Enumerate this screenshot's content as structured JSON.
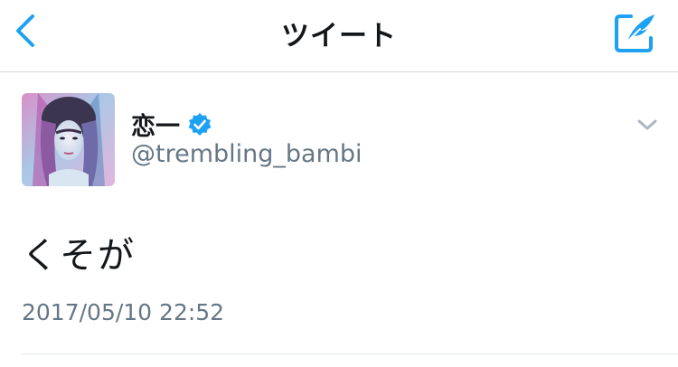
{
  "colors": {
    "accent": "#1da1f2",
    "text_primary": "#14171a",
    "text_secondary": "#657786",
    "divider": "#e1e8ed"
  },
  "navbar": {
    "back_icon": "chevron-left-icon",
    "title": "ツイート",
    "compose_icon": "compose-tweet-icon"
  },
  "tweet": {
    "author": {
      "display_name": "恋一",
      "verified": true,
      "handle": "@trembling_bambi"
    },
    "menu_icon": "chevron-down-icon",
    "text": "くそが",
    "timestamp": "2017/05/10 22:52"
  }
}
